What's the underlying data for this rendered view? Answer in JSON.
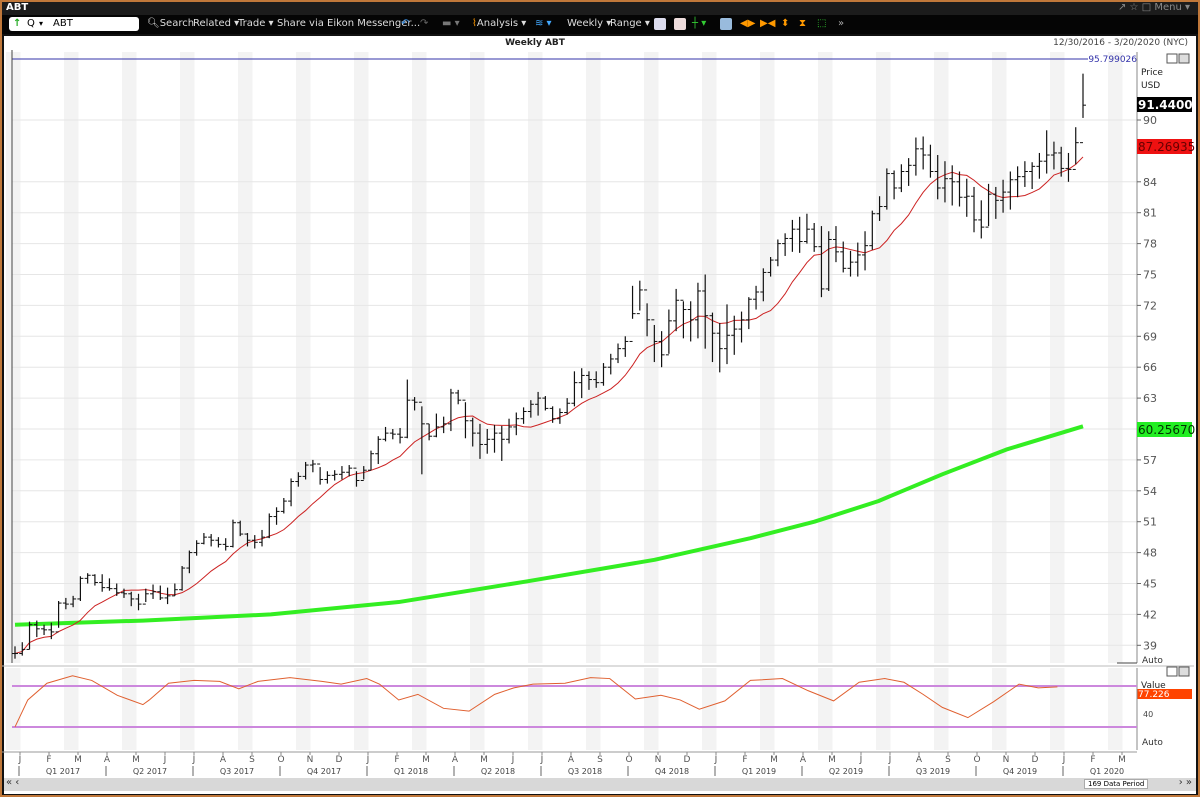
{
  "window": {
    "title": "ABT",
    "menu": "Menu ▾",
    "icons": [
      "pin-icon",
      "star-icon",
      "restore-icon"
    ]
  },
  "toolbar": {
    "symbol": "ABT",
    "quote_mode": "Q",
    "search": "Search",
    "related": "Related ▾",
    "trade": "Trade ▾",
    "share": "Share via Eikon Messenger...",
    "analysis": "Analysis ▾",
    "interval": "Weekly ▾",
    "range": "Range ▾"
  },
  "chart": {
    "title": "Weekly ABT",
    "date_range": "12/30/2016 - 3/20/2020 (NYC)",
    "ref_line_label": "95.799026",
    "axis_title": "Price",
    "axis_unit": "USD",
    "last_price": "91.4400",
    "ma_label": "87.26935",
    "long_ma_label": "60.25670",
    "auto_label": "Auto",
    "colors": {
      "bars": "#111111",
      "ma": "#cc2222",
      "long_ma": "#33ee22",
      "ref_line": "#3333aa",
      "last_price_bg": "#000000",
      "ma_bg": "#ee1111",
      "long_ma_bg": "#22ee22"
    }
  },
  "indicator": {
    "axis_title": "Value",
    "last_value": "77.226",
    "tick": "40",
    "auto_label": "Auto",
    "color": "#e06030",
    "band_color": "#cc88dd"
  },
  "chart_data": [
    {
      "type": "ohlc",
      "title": "Weekly ABT",
      "ylabel": "Price USD",
      "ylim": [
        37.5,
        96
      ],
      "yticks": [
        39,
        42,
        45,
        48,
        51,
        54,
        57,
        60,
        63,
        66,
        69,
        72,
        75,
        78,
        81,
        84,
        90
      ],
      "reference_line": 95.799026,
      "bars_low_high_close": [
        [
          37.7,
          38.9,
          38.2
        ],
        [
          38.0,
          39.3,
          38.6
        ],
        [
          38.6,
          41.3,
          41.0
        ],
        [
          39.8,
          41.4,
          40.6
        ],
        [
          40.0,
          41.0,
          40.5
        ],
        [
          39.6,
          41.2,
          40.3
        ],
        [
          40.7,
          43.3,
          43.1
        ],
        [
          42.5,
          43.6,
          43.0
        ],
        [
          42.7,
          43.8,
          43.5
        ],
        [
          43.3,
          45.7,
          45.5
        ],
        [
          45.0,
          46.0,
          45.8
        ],
        [
          44.8,
          45.9,
          45.1
        ],
        [
          44.2,
          45.9,
          44.6
        ],
        [
          44.3,
          45.5,
          44.5
        ],
        [
          43.8,
          45.0,
          44.1
        ],
        [
          43.6,
          44.5,
          44.0
        ],
        [
          42.8,
          44.2,
          43.5
        ],
        [
          42.4,
          44.0,
          43.0
        ],
        [
          43.2,
          44.5,
          44.0
        ],
        [
          43.5,
          44.9,
          44.2
        ],
        [
          43.4,
          44.8,
          43.6
        ],
        [
          43.0,
          44.6,
          43.8
        ],
        [
          43.8,
          45.0,
          44.4
        ],
        [
          44.3,
          46.7,
          46.5
        ],
        [
          46.0,
          48.2,
          48.0
        ],
        [
          47.7,
          49.2,
          48.9
        ],
        [
          48.8,
          49.9,
          49.5
        ],
        [
          48.6,
          49.8,
          49.2
        ],
        [
          48.5,
          49.5,
          48.8
        ],
        [
          48.2,
          49.4,
          48.6
        ],
        [
          48.5,
          51.2,
          50.9
        ],
        [
          49.6,
          51.1,
          49.8
        ],
        [
          48.6,
          49.9,
          49.2
        ],
        [
          48.4,
          49.7,
          49.0
        ],
        [
          48.6,
          50.2,
          49.5
        ],
        [
          49.4,
          51.8,
          51.5
        ],
        [
          50.7,
          52.4,
          52.0
        ],
        [
          51.8,
          53.3,
          53.0
        ],
        [
          52.5,
          55.2,
          54.9
        ],
        [
          54.4,
          55.8,
          55.4
        ],
        [
          55.1,
          56.8,
          56.5
        ],
        [
          55.8,
          57.0,
          56.6
        ],
        [
          54.6,
          56.3,
          55.1
        ],
        [
          54.7,
          55.9,
          55.5
        ],
        [
          55.0,
          56.0,
          55.6
        ],
        [
          55.1,
          56.4,
          55.8
        ],
        [
          55.4,
          56.5,
          56.2
        ],
        [
          54.4,
          55.9,
          55.0
        ],
        [
          55.1,
          56.4,
          56.0
        ],
        [
          56.0,
          57.9,
          57.6
        ],
        [
          56.6,
          59.3,
          59.0
        ],
        [
          58.8,
          60.2,
          59.6
        ],
        [
          59.0,
          60.0,
          59.5
        ],
        [
          58.6,
          60.1,
          59.2
        ],
        [
          59.1,
          64.8,
          62.8
        ],
        [
          61.8,
          63.1,
          62.6
        ],
        [
          55.6,
          62.2,
          60.5
        ],
        [
          58.9,
          60.5,
          59.3
        ],
        [
          59.2,
          61.5,
          60.2
        ],
        [
          59.6,
          61.2,
          60.5
        ],
        [
          59.8,
          63.9,
          63.5
        ],
        [
          62.4,
          63.8,
          62.8
        ],
        [
          59.1,
          62.6,
          60.8
        ],
        [
          58.3,
          61.1,
          59.6
        ],
        [
          57.1,
          60.5,
          58.5
        ],
        [
          57.6,
          60.0,
          59.0
        ],
        [
          57.7,
          60.4,
          59.6
        ],
        [
          56.9,
          60.3,
          59.0
        ],
        [
          58.6,
          61.0,
          60.2
        ],
        [
          59.4,
          61.6,
          61.0
        ],
        [
          60.5,
          62.1,
          61.7
        ],
        [
          61.1,
          62.8,
          62.4
        ],
        [
          61.3,
          63.6,
          63.0
        ],
        [
          61.8,
          63.2,
          62.0
        ],
        [
          60.6,
          62.2,
          61.0
        ],
        [
          60.5,
          62.0,
          61.6
        ],
        [
          61.4,
          63.0,
          62.5
        ],
        [
          62.2,
          65.6,
          64.5
        ],
        [
          63.0,
          65.9,
          65.2
        ],
        [
          63.8,
          65.6,
          64.8
        ],
        [
          64.0,
          65.6,
          64.5
        ],
        [
          64.2,
          66.4,
          66.0
        ],
        [
          65.3,
          67.3,
          66.8
        ],
        [
          66.4,
          68.3,
          67.8
        ],
        [
          67.0,
          69.0,
          68.5
        ],
        [
          70.7,
          73.9,
          71.2
        ],
        [
          71.5,
          74.4,
          73.5
        ],
        [
          69.0,
          72.2,
          70.6
        ],
        [
          66.5,
          70.1,
          68.5
        ],
        [
          66.0,
          69.5,
          67.2
        ],
        [
          67.3,
          71.6,
          70.5
        ],
        [
          69.5,
          73.6,
          72.5
        ],
        [
          68.8,
          72.4,
          71.6
        ],
        [
          68.5,
          72.4,
          70.6
        ],
        [
          68.8,
          74.2,
          73.4
        ],
        [
          67.8,
          75.0,
          71.0
        ],
        [
          66.5,
          71.3,
          69.3
        ],
        [
          65.5,
          70.3,
          67.8
        ],
        [
          66.3,
          72.1,
          69.1
        ],
        [
          67.2,
          71.0,
          69.7
        ],
        [
          68.4,
          71.4,
          70.6
        ],
        [
          69.7,
          72.8,
          72.6
        ],
        [
          71.6,
          73.9,
          73.3
        ],
        [
          72.4,
          75.6,
          75.2
        ],
        [
          74.8,
          76.7,
          76.4
        ],
        [
          75.8,
          78.4,
          78.0
        ],
        [
          76.8,
          79.0,
          78.5
        ],
        [
          77.2,
          80.3,
          79.4
        ],
        [
          77.1,
          80.6,
          78.2
        ],
        [
          78.0,
          80.9,
          79.4
        ],
        [
          77.2,
          80.0,
          77.7
        ],
        [
          72.8,
          79.7,
          73.6
        ],
        [
          73.4,
          79.2,
          78.4
        ],
        [
          76.2,
          79.7,
          77.2
        ],
        [
          75.2,
          78.2,
          75.6
        ],
        [
          74.8,
          77.3,
          76.2
        ],
        [
          74.8,
          78.1,
          76.9
        ],
        [
          75.4,
          79.2,
          77.8
        ],
        [
          77.4,
          81.2,
          80.9
        ],
        [
          80.2,
          82.6,
          81.6
        ],
        [
          81.3,
          85.3,
          84.8
        ],
        [
          82.3,
          85.1,
          83.4
        ],
        [
          83.0,
          85.7,
          85.0
        ],
        [
          83.6,
          86.3,
          85.6
        ],
        [
          84.6,
          88.3,
          87.2
        ],
        [
          85.2,
          88.4,
          86.6
        ],
        [
          84.4,
          87.6,
          85.0
        ],
        [
          82.3,
          86.6,
          83.4
        ],
        [
          82.0,
          86.0,
          84.3
        ],
        [
          81.7,
          85.6,
          84.0
        ],
        [
          81.6,
          85.0,
          82.5
        ],
        [
          80.6,
          84.3,
          82.6
        ],
        [
          79.1,
          83.5,
          80.3
        ],
        [
          78.5,
          82.2,
          79.6
        ],
        [
          79.7,
          83.8,
          82.8
        ],
        [
          80.4,
          83.5,
          82.2
        ],
        [
          81.0,
          84.2,
          83.0
        ],
        [
          81.3,
          85.0,
          84.2
        ],
        [
          82.5,
          85.5,
          84.5
        ],
        [
          83.5,
          86.0,
          85.0
        ],
        [
          83.3,
          85.9,
          85.5
        ],
        [
          84.3,
          86.8,
          86.0
        ],
        [
          84.8,
          89.0,
          86.6
        ],
        [
          85.2,
          87.9,
          86.8
        ],
        [
          84.5,
          87.4,
          85.3
        ],
        [
          84.0,
          86.8,
          85.2
        ],
        [
          85.7,
          89.3,
          87.8
        ],
        [
          90.2,
          94.5,
          91.44
        ]
      ],
      "long_ma_points": [
        [
          0,
          41.0
        ],
        [
          20,
          41.4
        ],
        [
          40,
          42.0
        ],
        [
          60,
          43.2
        ],
        [
          80,
          45.2
        ],
        [
          100,
          47.3
        ],
        [
          115,
          49.4
        ],
        [
          125,
          51.0
        ],
        [
          135,
          53.0
        ],
        [
          145,
          55.6
        ],
        [
          155,
          58.0
        ],
        [
          167,
          60.26
        ]
      ],
      "ma_period": 10
    },
    {
      "type": "line",
      "ylabel": "Value",
      "ylim": [
        15,
        90
      ],
      "bands": [
        70,
        30
      ],
      "last_value": 77.226,
      "points": [
        [
          0,
          26
        ],
        [
          2,
          55
        ],
        [
          5,
          73
        ],
        [
          9,
          81
        ],
        [
          12,
          76
        ],
        [
          16,
          60
        ],
        [
          20,
          50
        ],
        [
          21,
          55
        ],
        [
          24,
          73
        ],
        [
          28,
          76
        ],
        [
          32,
          75
        ],
        [
          35,
          67
        ],
        [
          38,
          75
        ],
        [
          43,
          79
        ],
        [
          48,
          75
        ],
        [
          51,
          72
        ],
        [
          55,
          78
        ],
        [
          57,
          72
        ],
        [
          60,
          55
        ],
        [
          63,
          61
        ],
        [
          67,
          46
        ],
        [
          71,
          43
        ],
        [
          75,
          61
        ],
        [
          78,
          68
        ],
        [
          81,
          72
        ],
        [
          86,
          73
        ],
        [
          90,
          79
        ],
        [
          93,
          78
        ],
        [
          97,
          56
        ],
        [
          101,
          60
        ],
        [
          104,
          55
        ],
        [
          107,
          45
        ],
        [
          111,
          54
        ],
        [
          115,
          76
        ],
        [
          120,
          78
        ],
        [
          124,
          65
        ],
        [
          128,
          54
        ],
        [
          132,
          74
        ],
        [
          136,
          78
        ],
        [
          139,
          74
        ],
        [
          142,
          61
        ],
        [
          145,
          47
        ],
        [
          149,
          36
        ],
        [
          153,
          53
        ],
        [
          157,
          72
        ],
        [
          160,
          68
        ],
        [
          163,
          69
        ]
      ]
    }
  ],
  "time_axis": {
    "months": [
      "J",
      "F",
      "M",
      "A",
      "M",
      "J",
      "J",
      "A",
      "S",
      "O",
      "N",
      "D",
      "J",
      "F",
      "M",
      "A",
      "M",
      "J",
      "J",
      "A",
      "S",
      "O",
      "N",
      "D",
      "J",
      "F",
      "M",
      "A",
      "M",
      "J",
      "J",
      "A",
      "S",
      "O",
      "N",
      "D",
      "J",
      "F",
      "M"
    ],
    "quarters": [
      "Q1 2017",
      "Q2 2017",
      "Q3 2017",
      "Q4 2017",
      "Q1 2018",
      "Q2 2018",
      "Q3 2018",
      "Q4 2018",
      "Q1 2019",
      "Q2 2019",
      "Q3 2019",
      "Q4 2019",
      "Q1 2020"
    ]
  },
  "scrollbar": {
    "data_period": "169 Data Period"
  }
}
